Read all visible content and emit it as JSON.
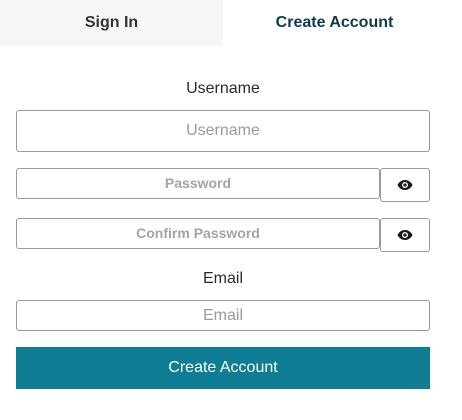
{
  "tabs": [
    {
      "label": "Sign In"
    },
    {
      "label": "Create Account"
    }
  ],
  "form": {
    "username_label": "Username",
    "username_placeholder": "Username",
    "password_placeholder": "Password",
    "confirm_password_placeholder": "Confirm Password",
    "email_label": "Email",
    "email_placeholder": "Email",
    "submit_label": "Create Account"
  },
  "icons": {
    "password_toggle": "eye-icon",
    "confirm_toggle": "eye-icon"
  },
  "colors": {
    "primary": "#0f7d93",
    "active_tab_text": "#0b3b4f",
    "inactive_tab_bg": "#f6f6f6"
  }
}
